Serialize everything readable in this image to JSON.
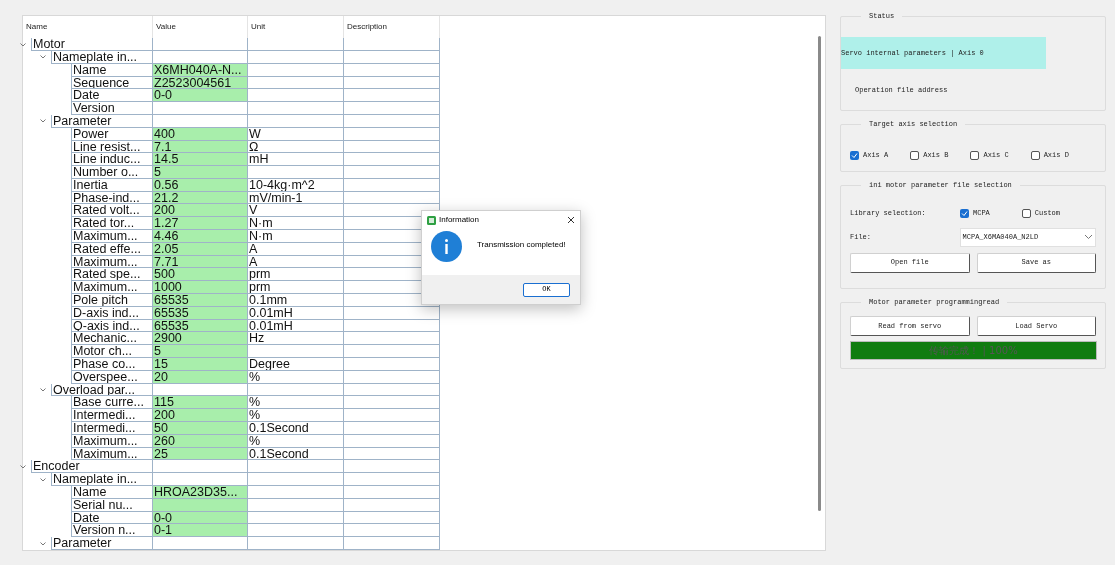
{
  "table": {
    "columns": [
      "Name",
      "Value",
      "Unit",
      "Description"
    ],
    "rows": [
      {
        "name": "Motor",
        "expanded": true,
        "children": [
          {
            "name": "Nameplate in...",
            "expanded": true,
            "children": [
              {
                "name": "Name",
                "value": "X6MH040A-N...",
                "highlighted": true
              },
              {
                "name": "Sequence",
                "value": "Z2523004561",
                "highlighted": true
              },
              {
                "name": "Date",
                "value": "0-0",
                "highlighted": true
              },
              {
                "name": "Version",
                "highlighted": false
              }
            ]
          },
          {
            "name": "Parameter",
            "expanded": true,
            "children": [
              {
                "name": "Power",
                "value": "400",
                "unit": "W",
                "highlighted": true
              },
              {
                "name": "Line resist...",
                "value": "7.1",
                "unit": "Ω",
                "highlighted": true
              },
              {
                "name": "Line induc...",
                "value": "14.5",
                "unit": "mH",
                "highlighted": true
              },
              {
                "name": "Number o...",
                "value": "5",
                "highlighted": true
              },
              {
                "name": "Inertia",
                "value": "0.56",
                "unit": "10-4kg·m^2",
                "highlighted": true
              },
              {
                "name": "Phase-ind...",
                "value": "21.2",
                "unit": "mV/min-1",
                "highlighted": true
              },
              {
                "name": "Rated volt...",
                "value": "200",
                "unit": "V",
                "highlighted": true
              },
              {
                "name": "Rated tor...",
                "value": "1.27",
                "unit": "N·m",
                "highlighted": true
              },
              {
                "name": "Maximum...",
                "value": "4.46",
                "unit": "N·m",
                "highlighted": true
              },
              {
                "name": "Rated effe...",
                "value": "2.05",
                "unit": "A",
                "highlighted": true
              },
              {
                "name": "Maximum...",
                "value": "7.71",
                "unit": "A",
                "highlighted": true
              },
              {
                "name": "Rated spe...",
                "value": "500",
                "unit": "prm",
                "highlighted": true
              },
              {
                "name": "Maximum...",
                "value": "1000",
                "unit": "prm",
                "highlighted": true
              },
              {
                "name": "Pole pitch",
                "value": "65535",
                "unit": "0.1mm",
                "highlighted": true
              },
              {
                "name": "D-axis ind...",
                "value": "65535",
                "unit": "0.01mH",
                "highlighted": true
              },
              {
                "name": "Q-axis ind...",
                "value": "65535",
                "unit": "0.01mH",
                "highlighted": true
              },
              {
                "name": "Mechanic...",
                "value": "2900",
                "unit": "Hz",
                "highlighted": true
              },
              {
                "name": "Motor ch...",
                "value": "5",
                "highlighted": true
              },
              {
                "name": "Phase co...",
                "value": "15",
                "unit": "Degree",
                "highlighted": true
              },
              {
                "name": "Overspee...",
                "value": "20",
                "unit": "%",
                "highlighted": true
              }
            ]
          },
          {
            "name": "Overload par...",
            "expanded": true,
            "children": [
              {
                "name": "Base curre...",
                "value": "115",
                "unit": "%",
                "highlighted": true
              },
              {
                "name": "Intermedi...",
                "value": "200",
                "unit": "%",
                "highlighted": true
              },
              {
                "name": "Intermedi...",
                "value": "50",
                "unit": "0.1Second",
                "highlighted": true
              },
              {
                "name": "Maximum...",
                "value": "260",
                "unit": "%",
                "highlighted": true
              },
              {
                "name": "Maximum...",
                "value": "25",
                "unit": "0.1Second",
                "highlighted": true
              }
            ]
          }
        ]
      },
      {
        "name": "Encoder",
        "expanded": true,
        "children": [
          {
            "name": "Nameplate in...",
            "expanded": true,
            "children": [
              {
                "name": "Name",
                "value": "HROA23D35...",
                "highlighted": true
              },
              {
                "name": "Serial nu...",
                "highlighted": true
              },
              {
                "name": "Date",
                "value": "0-0",
                "highlighted": true
              },
              {
                "name": "Version n...",
                "value": "0-1",
                "highlighted": true
              }
            ]
          },
          {
            "name": "Parameter",
            "expanded": true
          }
        ]
      }
    ]
  },
  "status": {
    "title": "Status",
    "current": "Servo internal parameters | Axis 0",
    "file_address_label": "Operation file address"
  },
  "target_axis": {
    "title": "Target axis selection",
    "axes": [
      {
        "label": "Axis A",
        "checked": true
      },
      {
        "label": "Axis B",
        "checked": false
      },
      {
        "label": "Axis C",
        "checked": false
      },
      {
        "label": "Axis D",
        "checked": false
      }
    ]
  },
  "file_selection": {
    "title": "ini motor parameter file selection",
    "library_label": "Library selection:",
    "libraries": [
      {
        "label": "MCPA",
        "checked": true
      },
      {
        "label": "Custom",
        "checked": false
      }
    ],
    "file_label": "File:",
    "file_value": "MCPA_X6MA040A_N2LD",
    "buttons": [
      "Open file",
      "Save as"
    ]
  },
  "programming": {
    "title": "Motor parameter programmingread",
    "buttons": [
      "Read from servo",
      "Load Servo"
    ],
    "progress": {
      "text": "传输完成！ | 100%",
      "level": 1
    }
  },
  "dialog": {
    "title": "Information",
    "message": "Transmission completed!",
    "button": "OK"
  }
}
